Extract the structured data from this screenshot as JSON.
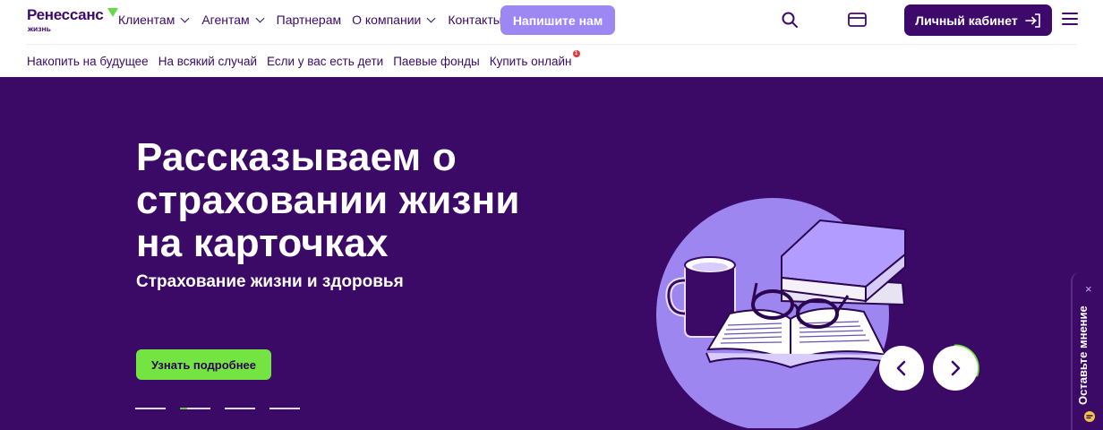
{
  "brand": {
    "name": "Ренессанс",
    "sub": "жизнь",
    "accent": "#66d94a",
    "primary": "#3d0a6b"
  },
  "nav": {
    "items": [
      {
        "label": "Клиентам",
        "dropdown": true
      },
      {
        "label": "Агентам",
        "dropdown": true
      },
      {
        "label": "Партнерам",
        "dropdown": false
      },
      {
        "label": "О компании",
        "dropdown": true
      },
      {
        "label": "Контакты",
        "dropdown": false
      }
    ],
    "write_button": "Напишите нам",
    "cabinet_button": "Личный кабинет",
    "icons": [
      "search-icon",
      "card-icon",
      "login-icon",
      "menu-icon"
    ]
  },
  "subnav": {
    "items": [
      {
        "label": "Накопить на будущее"
      },
      {
        "label": "На всякий случай"
      },
      {
        "label": "Если у вас есть дети"
      },
      {
        "label": "Паевые фонды"
      },
      {
        "label": "Купить онлайн",
        "badge": "1"
      }
    ]
  },
  "hero": {
    "title": "Рассказываем о страховании жизни на карточках",
    "subtitle": "Страхование жизни и здоровья",
    "cta": "Узнать подробнее",
    "slide_count": 4,
    "active_slide": 2,
    "background": "#3b0966",
    "cta_color": "#74e443"
  },
  "feedback": {
    "label": "Оставьте мнение",
    "close": "×"
  }
}
